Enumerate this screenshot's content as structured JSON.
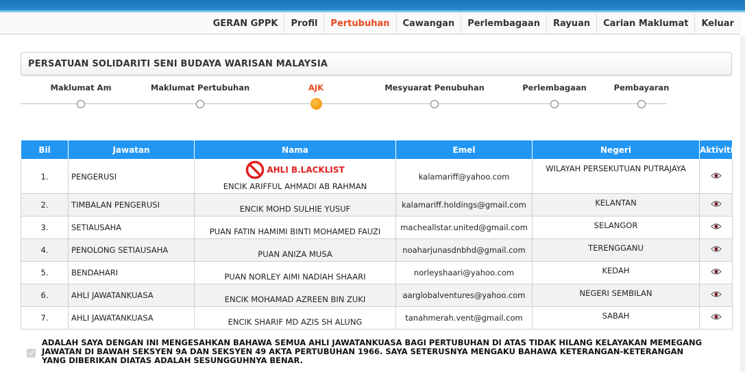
{
  "nav": {
    "items": [
      "GERAN GPPK",
      "Profil",
      "Pertubuhan",
      "Cawangan",
      "Perlembagaan",
      "Rayuan",
      "Carian Maklumat",
      "Keluar"
    ],
    "active": "Pertubuhan"
  },
  "page_title": "PERSATUAN SOLIDARITI SENI BUDAYA WARISAN MALAYSIA",
  "steps": [
    {
      "label": "Maklumat Am",
      "active": false
    },
    {
      "label": "Maklumat Pertubuhan",
      "active": false
    },
    {
      "label": "AJK",
      "active": true
    },
    {
      "label": "Mesyuarat Penubuhan",
      "active": false
    },
    {
      "label": "Perlembagaan",
      "active": false
    },
    {
      "label": "Pembayaran",
      "active": false
    }
  ],
  "table": {
    "headers": [
      "Bil",
      "Jawatan",
      "Nama",
      "Emel",
      "Negeri",
      "Aktiviti"
    ],
    "rows": [
      {
        "bil": "1.",
        "jawatan": "PENGERUSI",
        "badge": "AHLI B.LACKLIST",
        "nama": "ENCIK ARIFFUL AHMADI AB RAHMAN",
        "emel": "kalamariff@yahoo.com",
        "negeri": "WILAYAH PERSEKUTUAN PUTRAJAYA"
      },
      {
        "bil": "2.",
        "jawatan": "TIMBALAN PENGERUSI",
        "nama": "ENCIK MOHD SULHIE YUSUF",
        "emel": "kalamariff.holdings@gmail.com",
        "negeri": "KELANTAN"
      },
      {
        "bil": "3.",
        "jawatan": "SETIAUSAHA",
        "nama": "PUAN FATIN HAMIMI BINTI MOHAMED FAUZI",
        "emel": "macheallstar.united@gmail.com",
        "negeri": "SELANGOR"
      },
      {
        "bil": "4.",
        "jawatan": "PENOLONG SETIAUSAHA",
        "nama": "PUAN ANIZA MUSA",
        "emel": "noaharjunasdnbhd@gmail.com",
        "negeri": "TERENGGANU"
      },
      {
        "bil": "5.",
        "jawatan": "BENDAHARI",
        "nama": "PUAN NORLEY AIMI NADIAH SHAARI",
        "emel": "norleyshaari@yahoo.com",
        "negeri": "KEDAH"
      },
      {
        "bil": "6.",
        "jawatan": "AHLI JAWATANKUASA",
        "nama": "ENCIK MOHAMAD AZREEN BIN ZUKI",
        "emel": "aarglobalventures@yahoo.com",
        "negeri": "NEGERI SEMBILAN"
      },
      {
        "bil": "7.",
        "jawatan": "AHLI JAWATANKUASA",
        "nama": "ENCIK SHARIF MD AZIS SH ALUNG",
        "emel": "tanahmerah.vent@gmail.com",
        "negeri": "SABAH"
      }
    ],
    "action_icon": "eye-icon"
  },
  "declaration": {
    "checked": true,
    "text": "ADALAH SAYA DENGAN INI MENGESAHKAN BAHAWA SEMUA AHLI JAWATANKUASA BAGI PERTUBUHAN DI ATAS TIDAK HILANG KELAYAKAN MEMEGANG JAWATAN DI BAWAH SEKSYEN 9A DAN SEKSYEN 49 AKTA PERTUBUHAN 1966. SAYA SETERUSNYA MENGAKU BAHAWA KETERANGAN-KETERANGAN YANG DIBERIKAN DIATAS ADALAH SESUNGGUHNYA BENAR."
  },
  "colors": {
    "accent": "#e8491d",
    "table_header": "#2196f3",
    "blacklist": "#e02020",
    "step_active": "#f29b0f"
  }
}
